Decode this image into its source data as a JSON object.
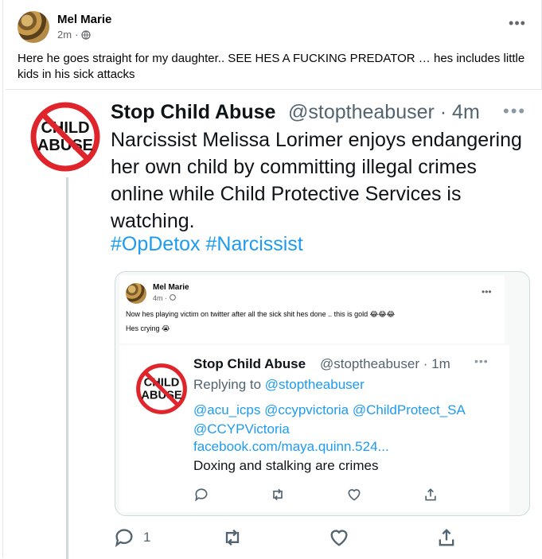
{
  "post": {
    "author": "Mel Marie",
    "time": "2m",
    "text": "Here he goes straight for my daughter.. SEE HES A FUCKING PREDATOR … hes includes little kids in his sick attacks"
  },
  "tweet": {
    "name": "Stop Child Abuse",
    "handle": "@stoptheabuser · 4m",
    "body": "Narcissist Melissa Lorimer enjoys endangering her own child by committing illegal crimes online while Child Protective Services is watching.",
    "hashtags": "#OpDetox #Narcissist",
    "avatar_text_top": "CHILD",
    "avatar_text_bottom": "ABUSE",
    "reply_count": "1",
    "quote": {
      "fb_author": "Mel Marie",
      "fb_time": "4m ·",
      "fb_line1": "Now hes playing victim on twitter after all the sick shit hes done .. this is gold 😂😂😂",
      "fb_line2": "Hes crying 😭",
      "inner_tweet": {
        "name": "Stop Child Abuse",
        "handle": "@stoptheabuser · 1m",
        "replying_prefix": "Replying to ",
        "replying_handle": "@stoptheabuser",
        "mentions": "@acu_icps @ccypvictoria @ChildProtect_SA @CCYPVictoria",
        "link": "facebook.com/maya.quinn.524...",
        "body": "Doxing and stalking are crimes"
      }
    }
  },
  "colors": {
    "link_blue": "#1d9bf0",
    "no_sign_red": "#e0242b"
  }
}
